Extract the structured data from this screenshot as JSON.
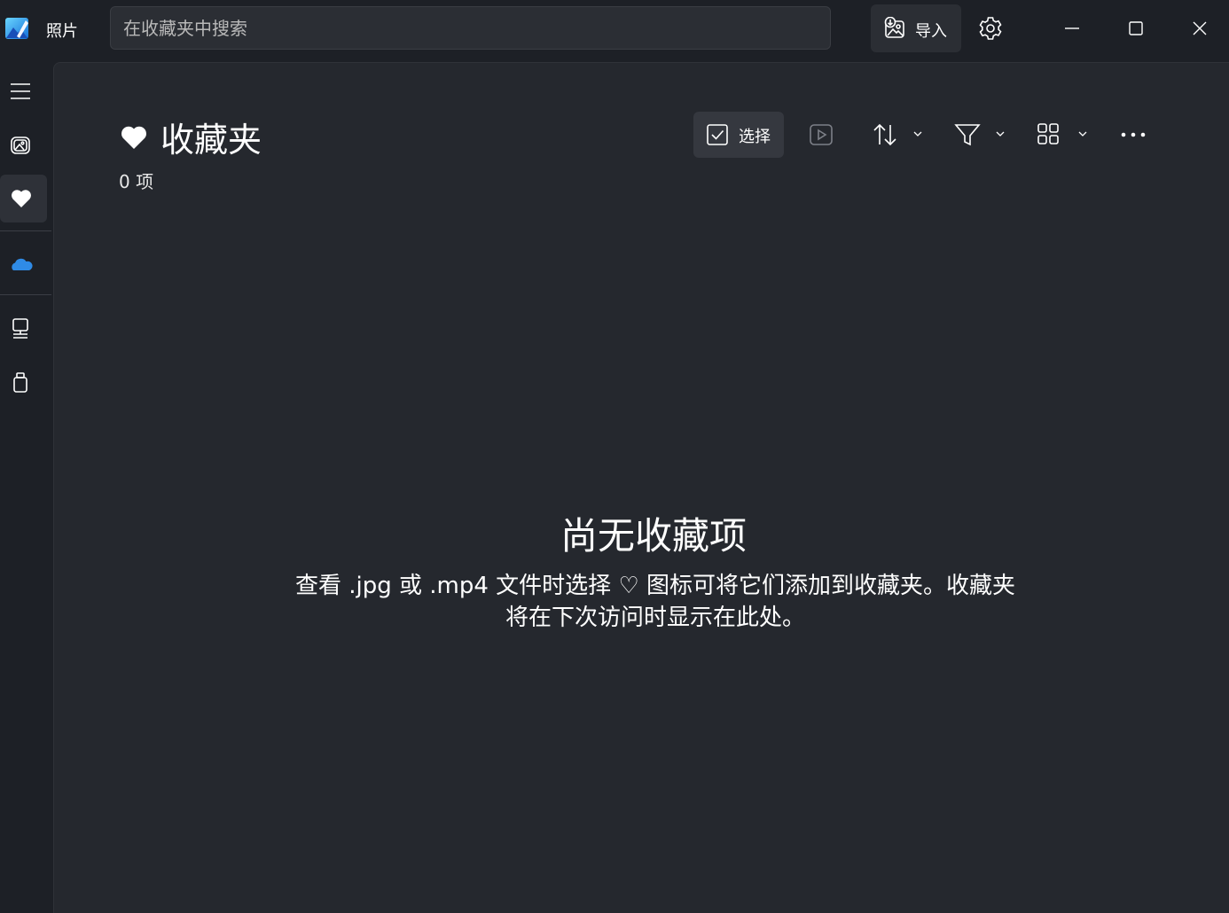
{
  "app": {
    "title": "照片"
  },
  "search": {
    "placeholder": "在收藏夹中搜索"
  },
  "header": {
    "import_label": "导入"
  },
  "page": {
    "title": "收藏夹",
    "count": "0 项"
  },
  "toolbar": {
    "select_label": "选择"
  },
  "empty_state": {
    "title": "尚无收藏项",
    "description": "查看 .jpg 或 .mp4 文件时选择 ♡ 图标可将它们添加到收藏夹。收藏夹将在下次访问时显示在此处。"
  },
  "nav": {
    "items": [
      {
        "icon": "hamburger-menu-icon"
      },
      {
        "icon": "photo-gallery-icon"
      },
      {
        "icon": "heart-icon",
        "active": true
      },
      {
        "icon": "onedrive-cloud-icon"
      },
      {
        "icon": "this-pc-icon"
      },
      {
        "icon": "usb-drive-icon"
      }
    ]
  },
  "colors": {
    "accent_cloud": "#2f8be6",
    "background": "#1d2026",
    "panel": "#25282e"
  }
}
